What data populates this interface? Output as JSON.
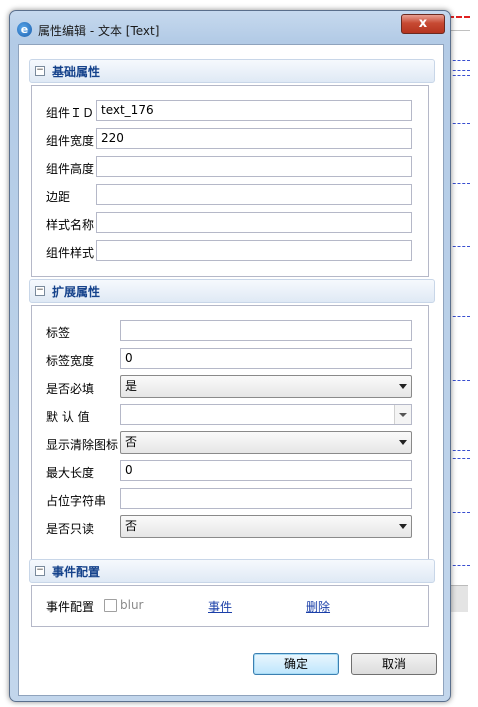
{
  "window": {
    "title": "属性编辑 - 文本 [Text]",
    "close_glyph": "x"
  },
  "basic": {
    "title": "基础属性",
    "fields": [
      {
        "label": "组件ＩＤ",
        "value": "text_176"
      },
      {
        "label": "组件宽度",
        "value": "220"
      },
      {
        "label": "组件高度",
        "value": ""
      },
      {
        "label": "边距",
        "value": ""
      },
      {
        "label": "样式名称",
        "value": ""
      },
      {
        "label": "组件样式",
        "value": ""
      }
    ]
  },
  "extended": {
    "title": "扩展属性",
    "label": {
      "label": "标签",
      "value": ""
    },
    "label_width": {
      "label": "标签宽度",
      "value": "0"
    },
    "required": {
      "label": "是否必填",
      "value": "是"
    },
    "default_value": {
      "label": "默 认 值",
      "value": ""
    },
    "show_clear": {
      "label": "显示清除图标",
      "value": "否"
    },
    "max_length": {
      "label": "最大长度",
      "value": "0"
    },
    "placeholder": {
      "label": "占位字符串",
      "value": ""
    },
    "readonly": {
      "label": "是否只读",
      "value": "否"
    }
  },
  "events": {
    "title": "事件配置",
    "row_label": "事件配置",
    "checkbox_label": "blur",
    "event_link": "事件",
    "delete_link": "删除"
  },
  "footer": {
    "ok": "确定",
    "cancel": "取消"
  }
}
